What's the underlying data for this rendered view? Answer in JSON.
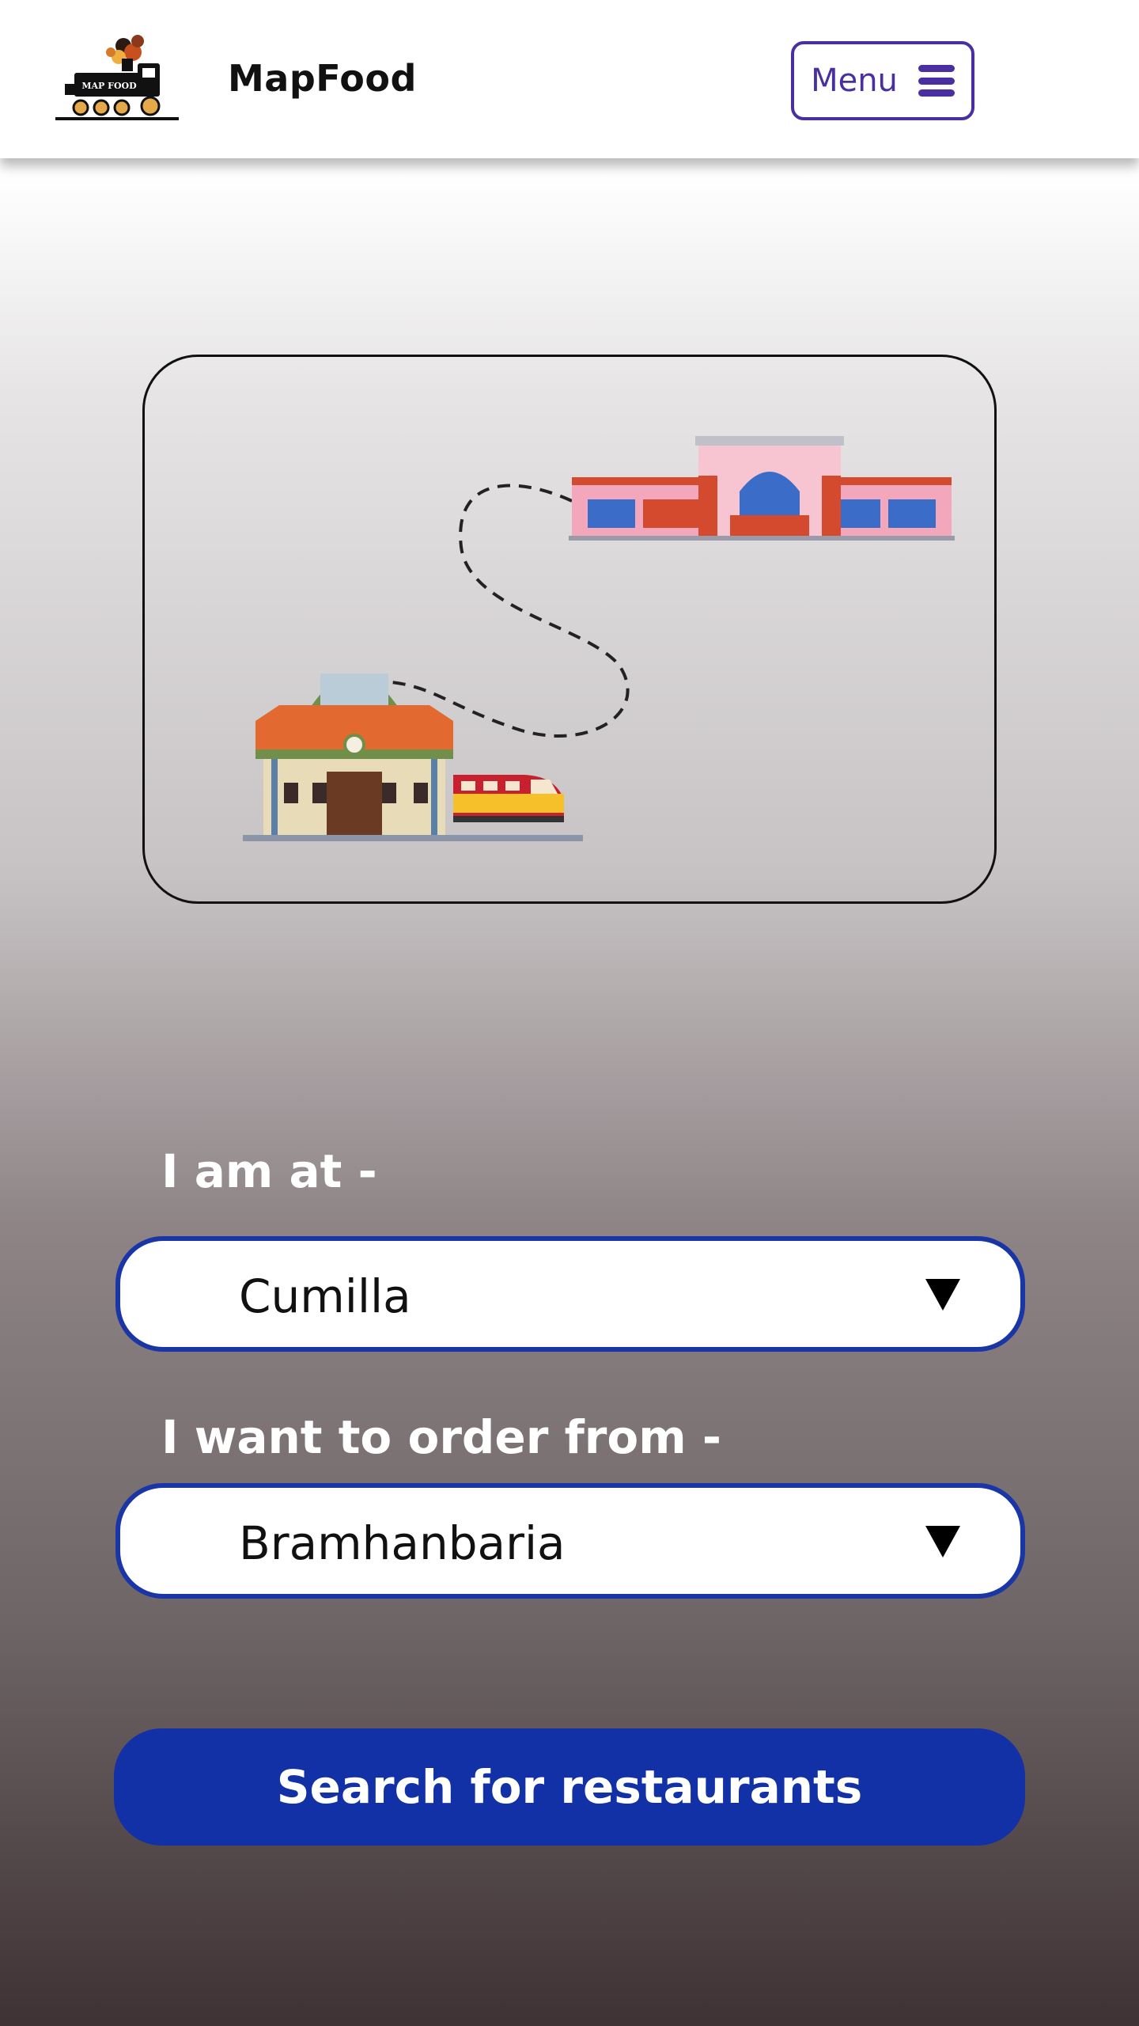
{
  "header": {
    "logo_text": "MAP FOOD",
    "brand": "MapFood",
    "menu_label": "Menu"
  },
  "form": {
    "from_label": "I am at -",
    "from_value": "Cumilla",
    "to_label": "I want to order from -",
    "to_value": "Bramhanbaria",
    "search_label": "Search for restaurants"
  },
  "colors": {
    "accent_purple": "#4a2fa0",
    "select_border": "#1a35a6",
    "button_blue": "#1331a6"
  },
  "icons": {
    "menu": "hamburger-icon",
    "dropdown": "triangle-down-icon"
  }
}
